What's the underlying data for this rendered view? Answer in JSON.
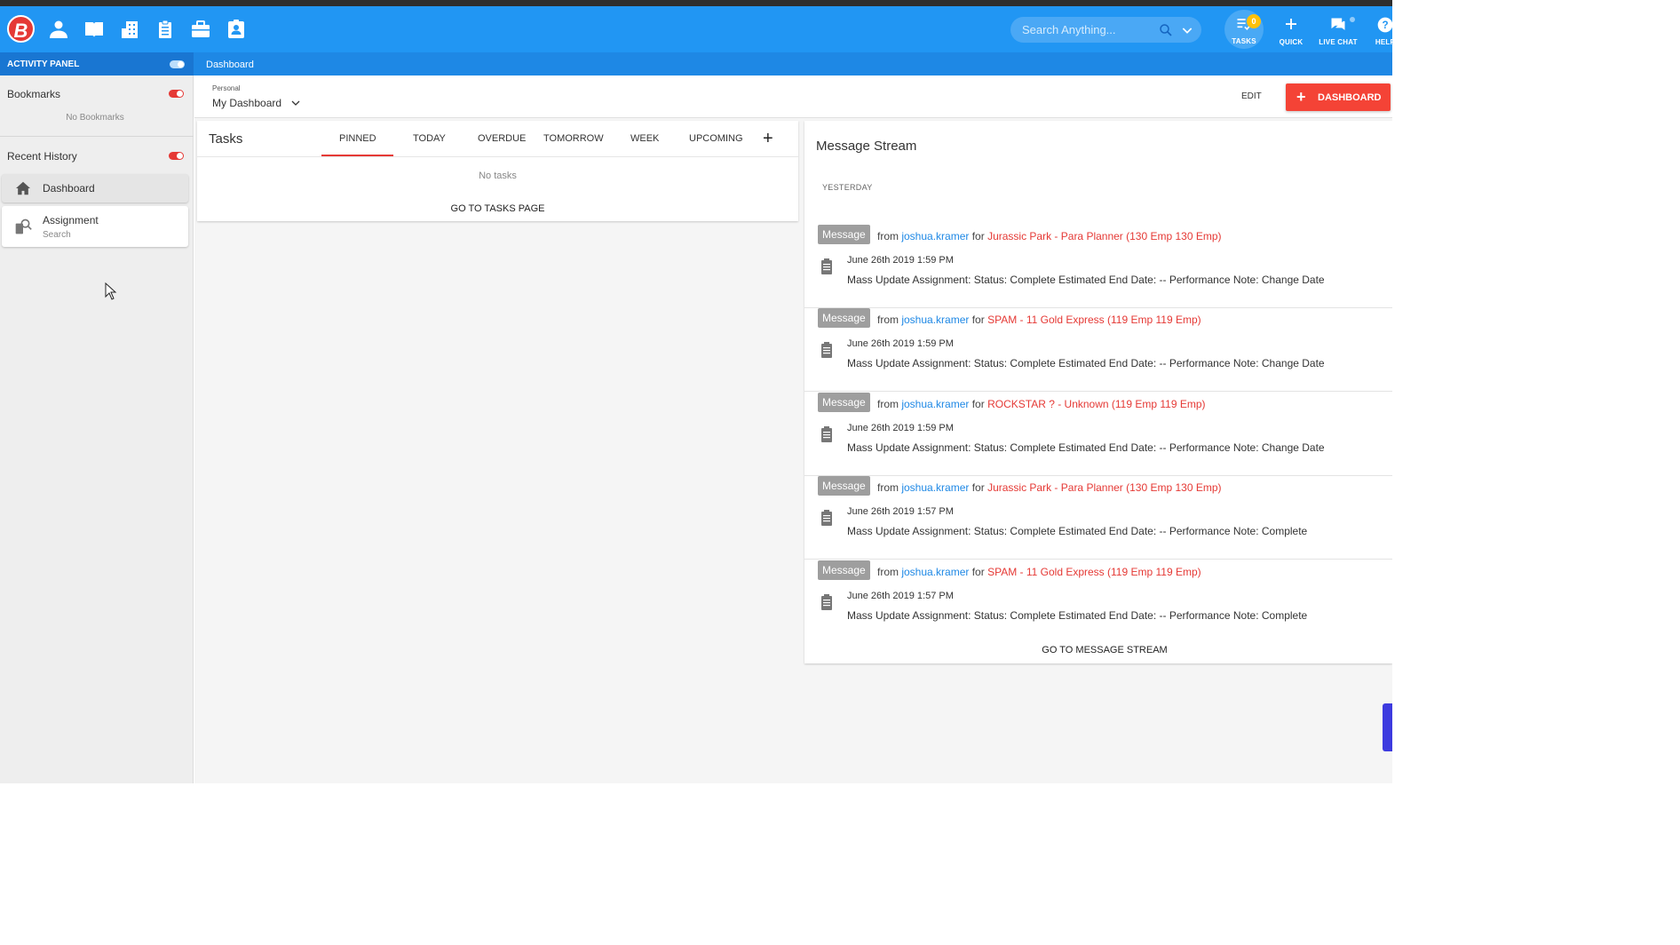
{
  "app": {
    "logo_letter": "B"
  },
  "nav_icons": [
    "person-icon",
    "book-icon",
    "building-icon",
    "clipboard-icon",
    "briefcase-icon",
    "contact-badge-icon"
  ],
  "search": {
    "placeholder": "Search Anything..."
  },
  "toolbar": {
    "tasks_label": "TASKS",
    "tasks_badge": "0",
    "quick_label": "QUICK",
    "livechat_label": "LIVE CHAT",
    "help_label": "HELP"
  },
  "activity_panel": {
    "label": "ACTIVITY PANEL"
  },
  "breadcrumb": "Dashboard",
  "sidebar": {
    "bookmarks_title": "Bookmarks",
    "bookmarks_empty": "No Bookmarks",
    "history_title": "Recent History",
    "history": [
      {
        "label": "Dashboard",
        "sub": ""
      },
      {
        "label": "Assignment",
        "sub": "Search"
      }
    ]
  },
  "dashboard": {
    "selector_label": "Personal",
    "selector_value": "My Dashboard",
    "edit_label": "EDIT",
    "add_label": "DASHBOARD"
  },
  "tasks": {
    "title": "Tasks",
    "tabs": [
      "PINNED",
      "TODAY",
      "OVERDUE",
      "TOMORROW",
      "WEEK",
      "UPCOMING"
    ],
    "active_tab": "PINNED",
    "empty": "No tasks",
    "goto": "GO TO TASKS PAGE"
  },
  "message_stream": {
    "title": "Message Stream",
    "day": "YESTERDAY",
    "messages": [
      {
        "badge": "Message",
        "from": "from",
        "user": "joshua.kramer",
        "for": "for",
        "target": "Jurassic Park - Para Planner (130 Emp 130 Emp)",
        "date": "June 26th 2019 1:59 PM",
        "text": "Mass Update Assignment: Status: Complete Estimated End Date: -- Performance Note: Change Date"
      },
      {
        "badge": "Message",
        "from": "from",
        "user": "joshua.kramer",
        "for": "for",
        "target": "SPAM - 11 Gold Express (119 Emp 119 Emp)",
        "date": "June 26th 2019 1:59 PM",
        "text": "Mass Update Assignment: Status: Complete Estimated End Date: -- Performance Note: Change Date"
      },
      {
        "badge": "Message",
        "from": "from",
        "user": "joshua.kramer",
        "for": "for",
        "target": "ROCKSTAR ? - Unknown (119 Emp 119 Emp)",
        "date": "June 26th 2019 1:59 PM",
        "text": "Mass Update Assignment: Status: Complete Estimated End Date: -- Performance Note: Change Date"
      },
      {
        "badge": "Message",
        "from": "from",
        "user": "joshua.kramer",
        "for": "for",
        "target": "Jurassic Park - Para Planner (130 Emp 130 Emp)",
        "date": "June 26th 2019 1:57 PM",
        "text": "Mass Update Assignment: Status: Complete Estimated End Date: -- Performance Note: Complete"
      },
      {
        "badge": "Message",
        "from": "from",
        "user": "joshua.kramer",
        "for": "for",
        "target": "SPAM - 11 Gold Express (119 Emp 119 Emp)",
        "date": "June 26th 2019 1:57 PM",
        "text": "Mass Update Assignment: Status: Complete Estimated End Date: -- Performance Note: Complete"
      }
    ],
    "goto": "GO TO MESSAGE STREAM"
  },
  "colors": {
    "appbar": "#2196f3",
    "accent_red": "#f44336",
    "link_blue": "#1e88e5",
    "target_red": "#e53935"
  }
}
